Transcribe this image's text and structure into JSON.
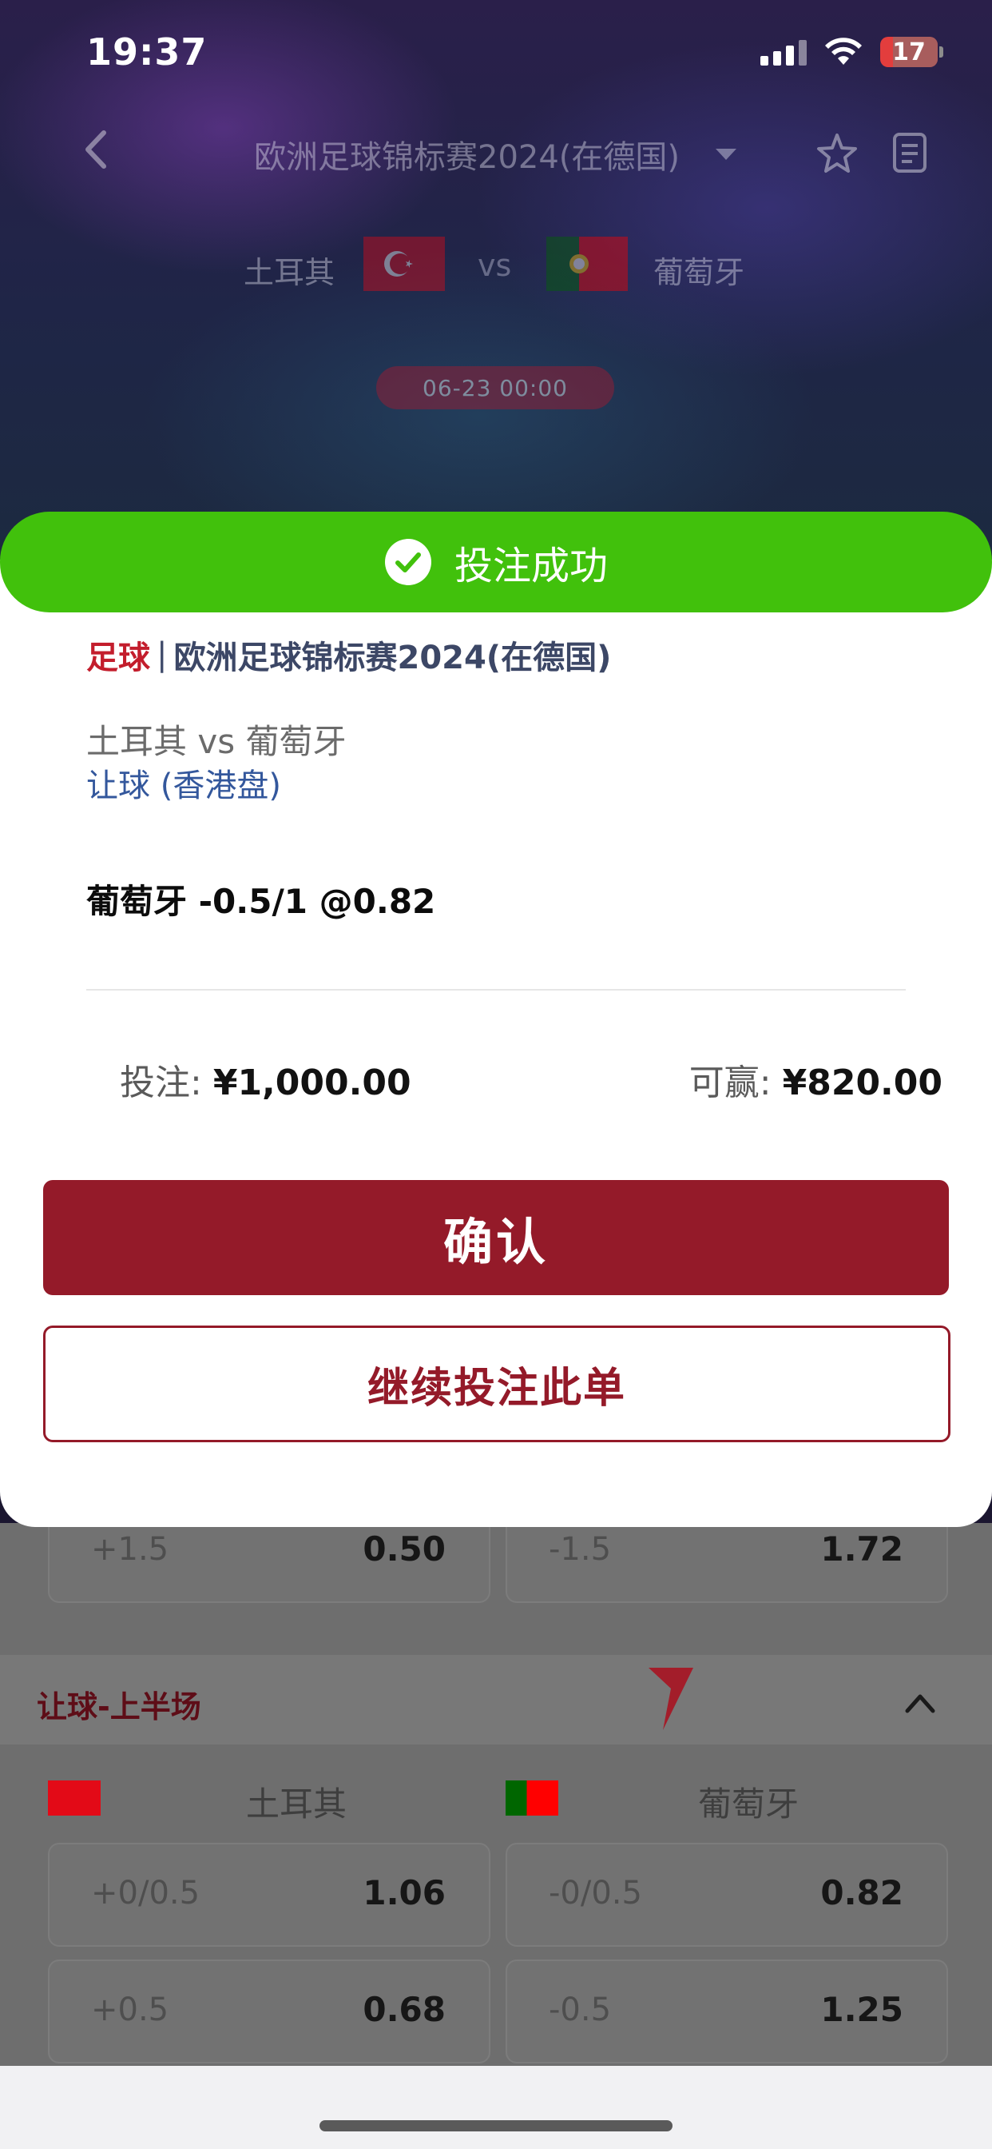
{
  "status_bar": {
    "time": "19:37",
    "battery": "17"
  },
  "header": {
    "title": "欧洲足球锦标赛2024(在德国)",
    "home_team": "土耳其",
    "vs": "vs",
    "away_team": "葡萄牙",
    "kickoff": "06-23 00:00"
  },
  "banner": {
    "text": "投注成功",
    "icon": "check-circle-icon",
    "color": "#41c10c"
  },
  "bet_slip": {
    "sport": "足球",
    "separator": "|",
    "league": "欧洲足球锦标赛2024(在德国)",
    "match": "土耳其 vs 葡萄牙",
    "market": "让球 (香港盘)",
    "selection": "葡萄牙 -0.5/1 @0.82",
    "stake_label": "投注:",
    "stake_value": "¥1,000.00",
    "win_label": "可赢:",
    "win_value": "¥820.00"
  },
  "buttons": {
    "confirm": "确认",
    "continue": "继续投注此单",
    "accent": "#941a29"
  },
  "background_markets": {
    "row_top": [
      {
        "handicap": "+1.5",
        "odds": "0.50"
      },
      {
        "handicap": "-1.5",
        "odds": "1.72"
      }
    ],
    "section_title": "让球-上半场",
    "columns": [
      "土耳其",
      "葡萄牙"
    ],
    "rows": [
      [
        {
          "handicap": "+0/0.5",
          "odds": "1.06"
        },
        {
          "handicap": "-0/0.5",
          "odds": "0.82"
        }
      ],
      [
        {
          "handicap": "+0.5",
          "odds": "0.68"
        },
        {
          "handicap": "-0.5",
          "odds": "1.25"
        }
      ]
    ]
  }
}
